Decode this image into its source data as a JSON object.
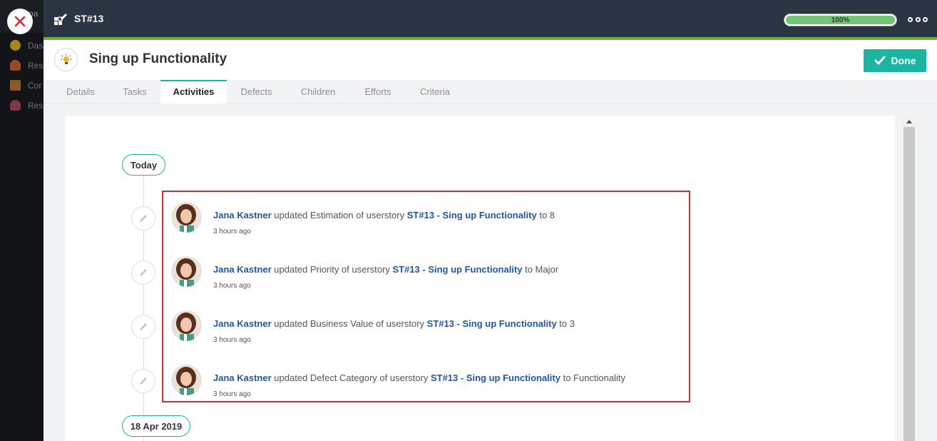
{
  "background_app": {
    "partial_title": "pa",
    "nav_items": [
      {
        "label": "Das",
        "icon": "dashboard-icon"
      },
      {
        "label": "Res",
        "icon": "person-icon"
      },
      {
        "label": "Cor",
        "icon": "calendar-icon"
      },
      {
        "label": "Res",
        "icon": "people-icon"
      }
    ]
  },
  "topbar": {
    "story_id": "ST#13",
    "progress_label": "100%",
    "progress_value": 100,
    "accent_color": "#6cb33e"
  },
  "header": {
    "title": "Sing up Functionality",
    "done_label": "Done",
    "done_color": "#1bb5a1"
  },
  "tabs": [
    {
      "label": "Details",
      "active": false
    },
    {
      "label": "Tasks",
      "active": false
    },
    {
      "label": "Activities",
      "active": true
    },
    {
      "label": "Defects",
      "active": false
    },
    {
      "label": "Children",
      "active": false
    },
    {
      "label": "Efforts",
      "active": false
    },
    {
      "label": "Criteria",
      "active": false
    }
  ],
  "timeline": {
    "groups": [
      {
        "date": "Today"
      },
      {
        "date": "18 Apr 2019"
      }
    ],
    "activities": [
      {
        "user": "Jana Kastner",
        "action": " updated Estimation of userstory ",
        "story": "ST#13 - Sing up Functionality",
        "suffix": " to 8",
        "time": "3 hours ago"
      },
      {
        "user": "Jana Kastner",
        "action": " updated Priority of userstory ",
        "story": "ST#13 - Sing up Functionality",
        "suffix": " to Major",
        "time": "3 hours ago"
      },
      {
        "user": "Jana Kastner",
        "action": " updated Business Value of userstory ",
        "story": "ST#13 - Sing up Functionality",
        "suffix": " to 3",
        "time": "3 hours ago"
      },
      {
        "user": "Jana Kastner",
        "action": " updated Defect Category of userstory ",
        "story": "ST#13 - Sing up Functionality",
        "suffix": " to Functionality",
        "time": "3 hours ago"
      }
    ]
  },
  "colors": {
    "link": "#1f57a8",
    "highlight": "#d62b2b"
  }
}
